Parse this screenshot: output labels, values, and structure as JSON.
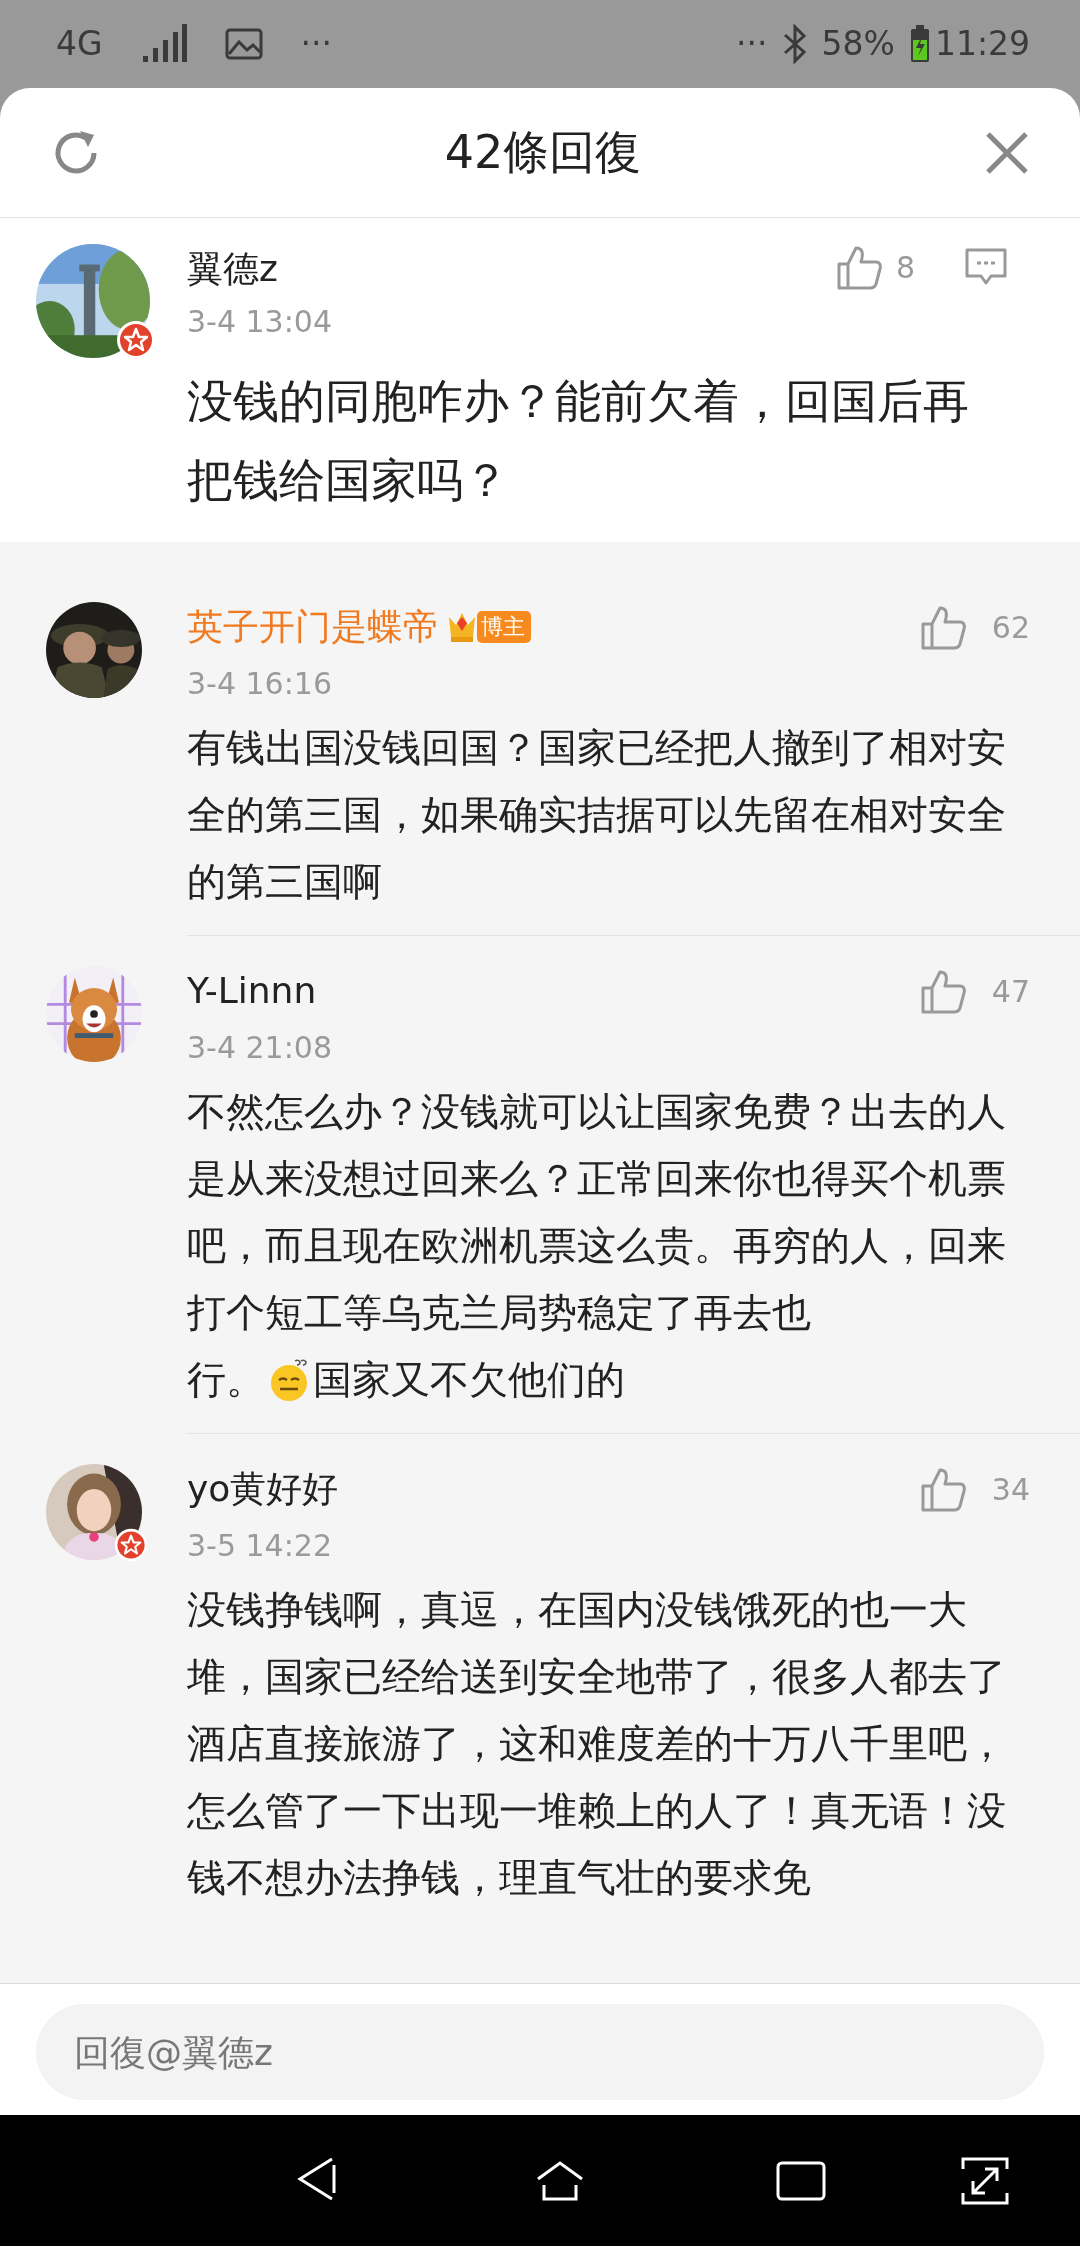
{
  "status_bar": {
    "network": "4G",
    "left_more": "···",
    "right_more": "···",
    "battery": "58%",
    "time": "11:29"
  },
  "header": {
    "title": "42條回復"
  },
  "main_comment": {
    "author": "翼德z",
    "verified": true,
    "time": "3-4 13:04",
    "likes": "8",
    "text": "没钱的同胞咋办？能前欠着，回国后再把钱给国家吗？"
  },
  "replies": [
    {
      "author": "英子开门是蝶帝",
      "badge": "博主",
      "verified": false,
      "time": "3-4 16:16",
      "likes": "62",
      "segments": [
        {
          "kind": "paragraph",
          "text": "有钱出国没钱回国？国家已经把人撤到了相对安全的第三国，如果确实拮据可以先留在相对安全的第三国啊"
        }
      ]
    },
    {
      "author": "Y-Linnn",
      "verified": false,
      "time": "3-4 21:08",
      "likes": "47",
      "segments": [
        {
          "kind": "paragraph",
          "text": "不然怎么办？没钱就可以让国家免费？出去的人是从来没想过回来么？正常回来你也得买个机票吧，而且现在欧洲机票这么贵。再穷的人，回来打个短工等乌克兰局势稳定了再去也"
        },
        {
          "kind": "text",
          "text": "行。"
        },
        {
          "kind": "emoji"
        },
        {
          "kind": "text",
          "text": "国家又不欠他们的"
        }
      ]
    },
    {
      "author": "yo黄好好",
      "verified": true,
      "time": "3-5 14:22",
      "likes": "34",
      "segments": [
        {
          "kind": "paragraph",
          "text": "没钱挣钱啊，真逗，在国内没钱饿死的也一大堆，国家已经给送到安全地带了，很多人都去了酒店直接旅游了，这和难度差的十万八千里吧，怎么管了一下出现一堆赖上的人了！真无语！没钱不想办法挣钱，理直气壮的要求免"
        }
      ]
    }
  ],
  "reply_box": {
    "placeholder": "回復@翼德z"
  }
}
